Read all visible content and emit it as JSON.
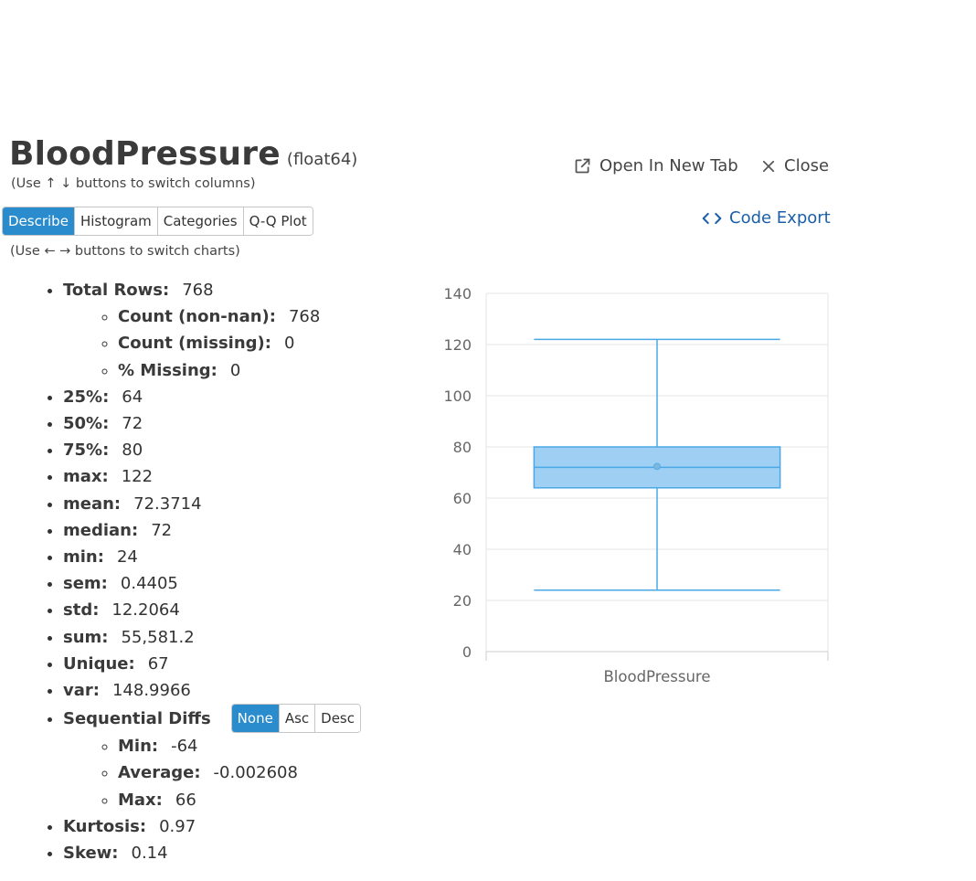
{
  "header": {
    "column_name": "BloodPressure",
    "column_type": "(float64)",
    "column_hint": "(Use ↑ ↓ buttons to switch columns)",
    "open_new_tab": "Open In New Tab",
    "close": "Close",
    "code_export": "Code Export"
  },
  "tabs": {
    "items": [
      "Describe",
      "Histogram",
      "Categories",
      "Q-Q Plot"
    ],
    "active": "Describe",
    "chart_hint": "(Use ← → buttons to switch charts)"
  },
  "stats": {
    "total_rows_label": "Total Rows:",
    "total_rows": "768",
    "count_nonnan_label": "Count (non-nan):",
    "count_nonnan": "768",
    "count_missing_label": "Count (missing):",
    "count_missing": "0",
    "pct_missing_label": "% Missing:",
    "pct_missing": "0",
    "p25_label": "25%:",
    "p25": "64",
    "p50_label": "50%:",
    "p50": "72",
    "p75_label": "75%:",
    "p75": "80",
    "max_label": "max:",
    "max": "122",
    "mean_label": "mean:",
    "mean": "72.3714",
    "median_label": "median:",
    "median": "72",
    "min_label": "min:",
    "min": "24",
    "sem_label": "sem:",
    "sem": "0.4405",
    "std_label": "std:",
    "std": "12.2064",
    "sum_label": "sum:",
    "sum": "55,581.2",
    "unique_label": "Unique:",
    "unique": "67",
    "var_label": "var:",
    "var": "148.9966",
    "seq_label": "Sequential Diffs",
    "seq_buttons": [
      "None",
      "Asc",
      "Desc"
    ],
    "seq_active": "None",
    "seq_min_label": "Min:",
    "seq_min": "-64",
    "seq_avg_label": "Average:",
    "seq_avg": "-0.002608",
    "seq_max_label": "Max:",
    "seq_max": "66",
    "kurtosis_label": "Kurtosis:",
    "kurtosis": "0.97",
    "skew_label": "Skew:",
    "skew": "0.14"
  },
  "chart_data": {
    "type": "box",
    "category": "BloodPressure",
    "min": 24,
    "q1": 64,
    "median": 72,
    "q3": 80,
    "max": 122,
    "mean": 72.3714,
    "ylim": [
      0,
      140
    ],
    "yticks": [
      0,
      20,
      40,
      60,
      80,
      100,
      120,
      140
    ],
    "grid": true,
    "colors": {
      "box_fill": "#9fd0f3",
      "box_stroke": "#4aa8e6",
      "grid": "#e6e6e6",
      "axis": "#cccccc",
      "tick_text": "#666666"
    }
  }
}
